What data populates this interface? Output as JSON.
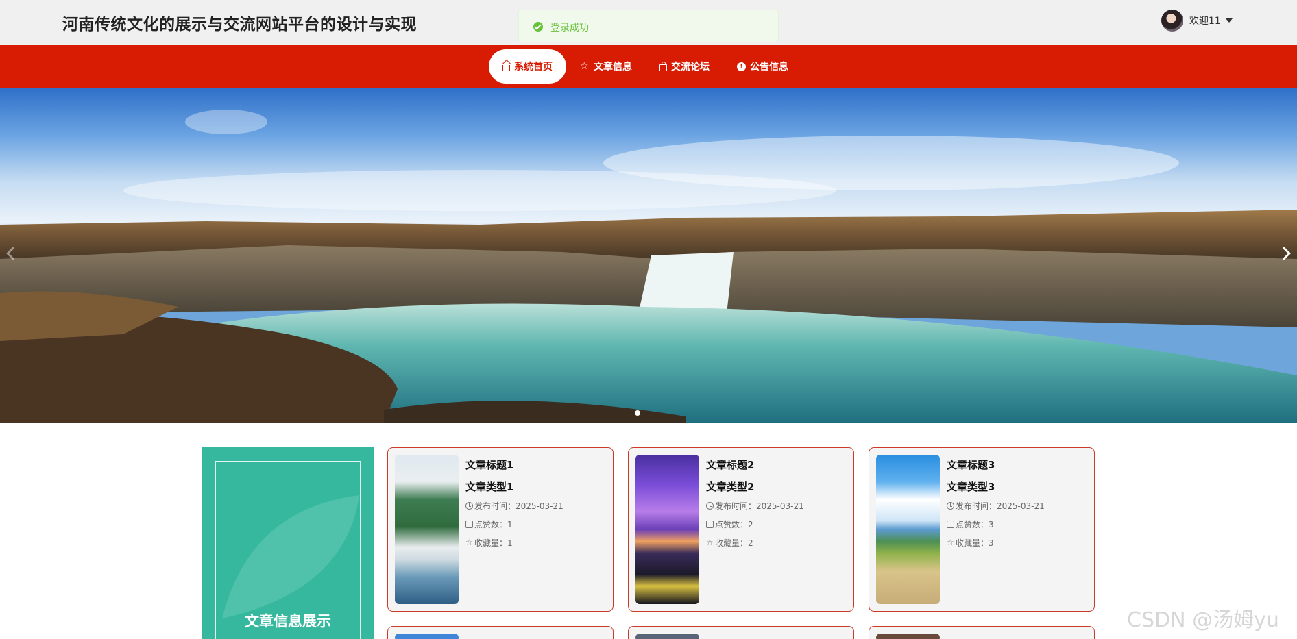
{
  "header": {
    "site_title": "河南传统文化的展示与交流网站平台的设计与实现",
    "toast_message": "登录成功",
    "welcome_text": "欢迎11"
  },
  "nav": {
    "items": [
      {
        "label": "系统首页",
        "icon": "home-icon",
        "active": true
      },
      {
        "label": "文章信息",
        "icon": "star-icon",
        "active": false
      },
      {
        "label": "交流论坛",
        "icon": "bag-icon",
        "active": false
      },
      {
        "label": "公告信息",
        "icon": "info-icon",
        "active": false
      }
    ]
  },
  "section": {
    "side_caption": "文章信息展示"
  },
  "articles": [
    {
      "title": "文章标题1",
      "type": "文章类型1",
      "publish": "发布时间：2025-03-21",
      "likes": "点赞数：1",
      "favorites": "收藏量：1"
    },
    {
      "title": "文章标题2",
      "type": "文章类型2",
      "publish": "发布时间：2025-03-21",
      "likes": "点赞数：2",
      "favorites": "收藏量：2"
    },
    {
      "title": "文章标题3",
      "type": "文章类型3",
      "publish": "发布时间：2025-03-21",
      "likes": "点赞数：3",
      "favorites": "收藏量：3"
    }
  ],
  "watermark": "CSDN @汤姆yu",
  "colors": {
    "nav_red": "#d81b03",
    "side_teal": "#36b89e",
    "card_border": "#cc3b2a",
    "toast_green": "#67c23a"
  }
}
